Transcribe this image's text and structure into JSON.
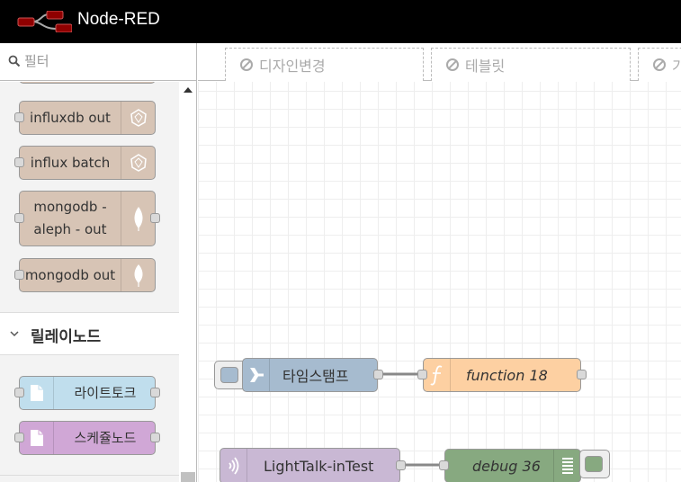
{
  "header": {
    "title": "Node-RED"
  },
  "palette": {
    "filter_placeholder": "필터",
    "nodes_storage": [
      {
        "label": "influxdb out"
      },
      {
        "label": "influx batch"
      },
      {
        "label": "mongodb - aleph - out"
      },
      {
        "label": "mongodb out"
      }
    ],
    "category_relay": {
      "label": "릴레이노드"
    },
    "nodes_relay": [
      {
        "label": "라이트토크"
      },
      {
        "label": "스케쥴노드"
      }
    ]
  },
  "tabs": [
    {
      "label": "디자인변경"
    },
    {
      "label": "테블릿"
    },
    {
      "label": "기"
    }
  ],
  "flow_nodes": {
    "inject": {
      "label": "타임스탬프"
    },
    "function": {
      "label": "function 18"
    },
    "lighttalk_in": {
      "label": "LightTalk-inTest"
    },
    "debug": {
      "label": "debug 36"
    }
  },
  "colors": {
    "storage_node": "#d7c4b5",
    "inject_node": "#a6bbcf",
    "function_node": "#fdd0a2",
    "lighttalk_node": "#c9b8d4",
    "debug_node": "#87a980",
    "relay_lighttalk": "#c0deed",
    "relay_schedule": "#d0a7d6"
  }
}
